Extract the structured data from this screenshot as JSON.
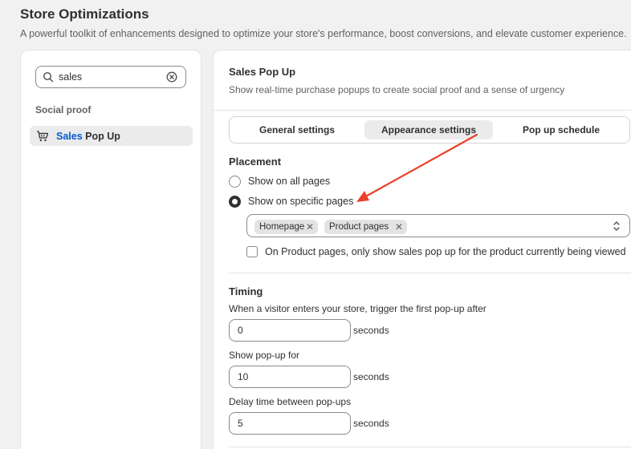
{
  "header": {
    "title": "Store Optimizations",
    "subtitle": "A powerful toolkit of enhancements designed to optimize your store's performance, boost conversions, and elevate customer experience."
  },
  "sidebar": {
    "search_value": "sales",
    "section_label": "Social proof",
    "item": {
      "highlight": "Sales",
      "rest": " Pop Up"
    }
  },
  "main": {
    "title": "Sales Pop Up",
    "description": "Show real-time purchase popups to create social proof and a sense of urgency",
    "tabs": [
      {
        "label": "General settings",
        "selected": false
      },
      {
        "label": "Appearance settings",
        "selected": true
      },
      {
        "label": "Pop up schedule",
        "selected": false
      }
    ],
    "placement": {
      "title": "Placement",
      "options": [
        {
          "label": "Show on all pages",
          "checked": false
        },
        {
          "label": "Show on specific pages",
          "checked": true
        }
      ],
      "chips": [
        "Homepage",
        "Product pages"
      ],
      "checkbox_label": "On Product pages, only show sales pop up for the product currently being viewed"
    },
    "timing": {
      "title": "Timing",
      "fields": [
        {
          "label": "When a visitor enters your store, trigger the first pop-up after",
          "value": "0",
          "unit": "seconds"
        },
        {
          "label": "Show pop-up for",
          "value": "10",
          "unit": "seconds"
        },
        {
          "label": "Delay time between pop-ups",
          "value": "5",
          "unit": "seconds"
        }
      ]
    }
  },
  "colors": {
    "accent_blue": "#005bd3",
    "annotation_arrow": "#e8412c"
  }
}
